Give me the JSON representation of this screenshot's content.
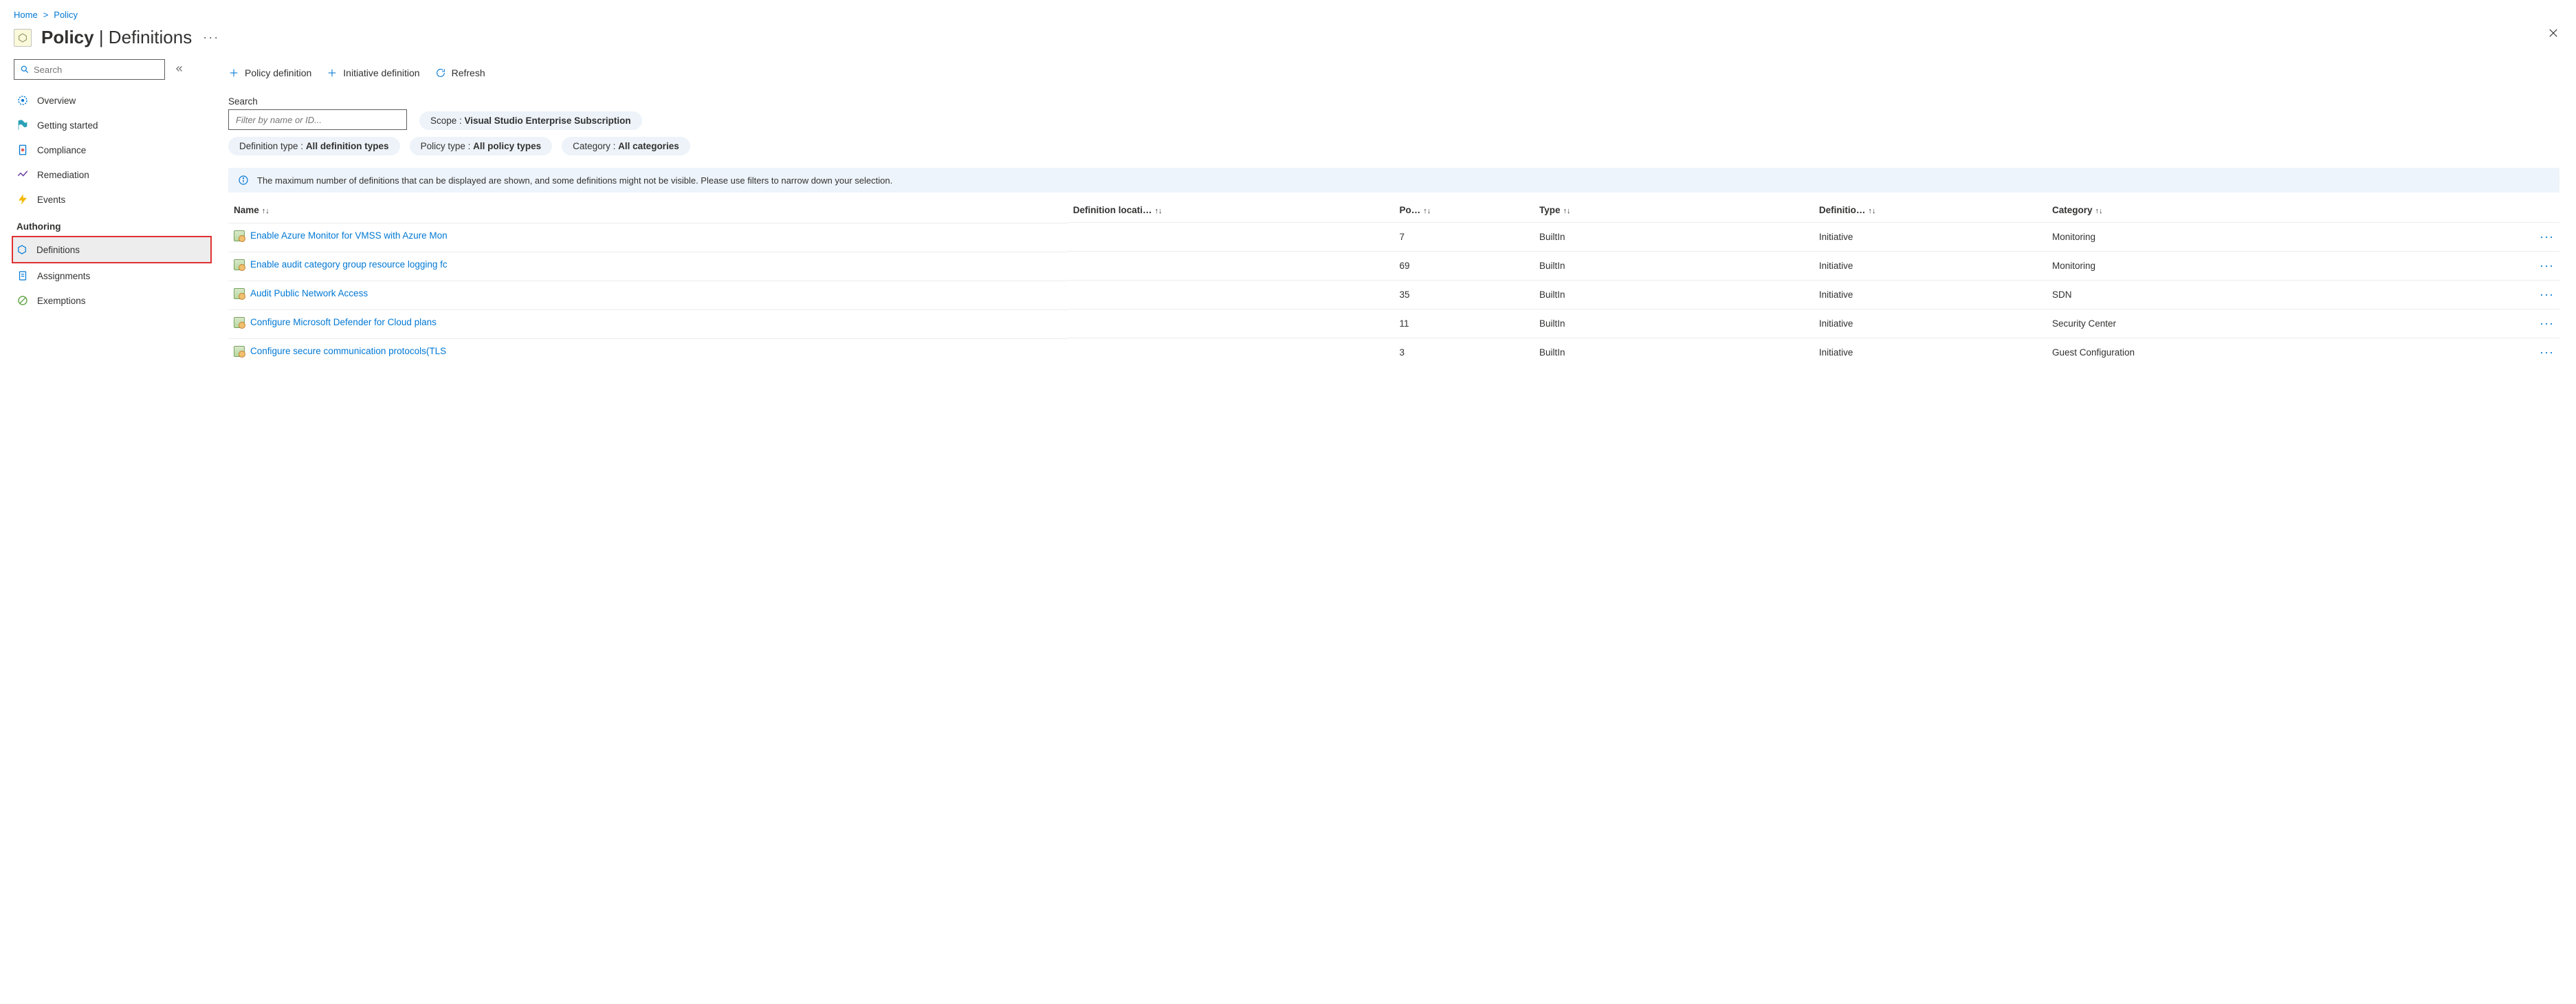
{
  "breadcrumb": {
    "home": "Home",
    "policy": "Policy"
  },
  "header": {
    "strong": "Policy",
    "sep": " | ",
    "rest": "Definitions",
    "more": "···"
  },
  "sidebar": {
    "search_placeholder": "Search",
    "items": [
      {
        "label": "Overview"
      },
      {
        "label": "Getting started"
      },
      {
        "label": "Compliance"
      },
      {
        "label": "Remediation"
      },
      {
        "label": "Events"
      }
    ],
    "section": "Authoring",
    "auth_items": [
      {
        "label": "Definitions"
      },
      {
        "label": "Assignments"
      },
      {
        "label": "Exemptions"
      }
    ]
  },
  "toolbar": {
    "policy_def": "Policy definition",
    "initiative_def": "Initiative definition",
    "refresh": "Refresh"
  },
  "filters": {
    "search_label": "Search",
    "search_placeholder": "Filter by name or ID...",
    "scope_label": "Scope : ",
    "scope_value": "Visual Studio Enterprise Subscription",
    "deftype_label": "Definition type : ",
    "deftype_value": "All definition types",
    "poltype_label": "Policy type : ",
    "poltype_value": "All policy types",
    "cat_label": "Category : ",
    "cat_value": "All categories"
  },
  "banner": "The maximum number of definitions that can be displayed are shown, and some definitions might not be visible. Please use filters to narrow down your selection.",
  "cols": {
    "name": "Name",
    "loc": "Definition locati…",
    "po": "Po…",
    "type": "Type",
    "def": "Definitio…",
    "cat": "Category"
  },
  "rows": [
    {
      "name": "Enable Azure Monitor for VMSS with Azure Mon",
      "po": "7",
      "type": "BuiltIn",
      "def": "Initiative",
      "cat": "Monitoring"
    },
    {
      "name": "Enable audit category group resource logging fc",
      "po": "69",
      "type": "BuiltIn",
      "def": "Initiative",
      "cat": "Monitoring"
    },
    {
      "name": "Audit Public Network Access",
      "po": "35",
      "type": "BuiltIn",
      "def": "Initiative",
      "cat": "SDN"
    },
    {
      "name": "Configure Microsoft Defender for Cloud plans",
      "po": "11",
      "type": "BuiltIn",
      "def": "Initiative",
      "cat": "Security Center"
    },
    {
      "name": "Configure secure communication protocols(TLS",
      "po": "3",
      "type": "BuiltIn",
      "def": "Initiative",
      "cat": "Guest Configuration"
    }
  ]
}
